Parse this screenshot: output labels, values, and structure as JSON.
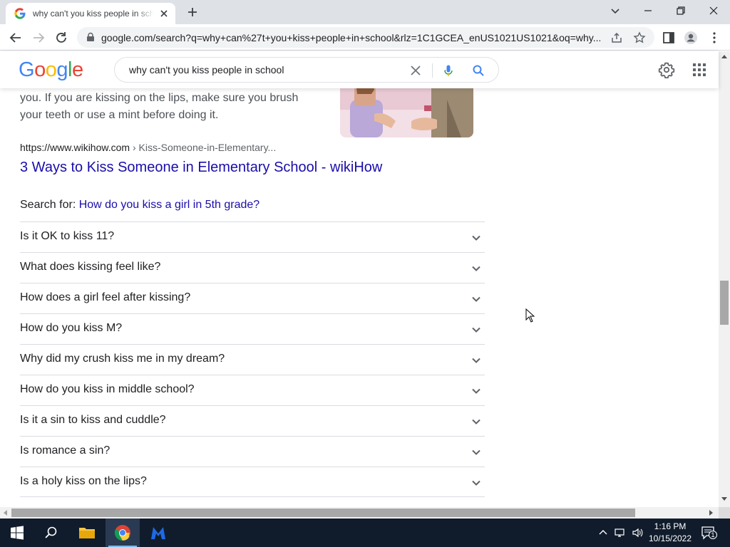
{
  "browser": {
    "tab_title": "why can't you kiss people in school - Google Search",
    "url": "google.com/search?q=why+can%27t+you+kiss+people+in+school&rlz=1C1GCEA_enUS1021US1021&oq=why..."
  },
  "google": {
    "logo": [
      "G",
      "o",
      "o",
      "g",
      "l",
      "e"
    ],
    "logo_colors": [
      "#4285f4",
      "#ea4335",
      "#fbbc05",
      "#4285f4",
      "#34a853",
      "#ea4335"
    ],
    "query": "why can't you kiss people in school"
  },
  "result": {
    "snippet_lines": [
      "you. If you are kissing on the lips, make sure you brush",
      "your teeth or use a mint before doing it."
    ],
    "cite_domain": "https://www.wikihow.com",
    "cite_path": " › Kiss-Someone-in-Elementary...",
    "title": "3 Ways to Kiss Someone in Elementary School - wikiHow"
  },
  "search_for": {
    "label": "Search for: ",
    "link": "How do you kiss a girl in 5th grade?"
  },
  "people_also_ask": [
    "Is it OK to kiss 11?",
    "What does kissing feel like?",
    "How does a girl feel after kissing?",
    "How do you kiss M?",
    "Why did my crush kiss me in my dream?",
    "How do you kiss in middle school?",
    "Is it a sin to kiss and cuddle?",
    "Is romance a sin?",
    "Is a holy kiss on the lips?"
  ],
  "taskbar": {
    "time": "1:16 PM",
    "date": "10/15/2022",
    "notification_count": "1"
  },
  "colors": {
    "link": "#1a0dab",
    "taskbar": "#101c2c",
    "tab_strip": "#dee1e6"
  }
}
